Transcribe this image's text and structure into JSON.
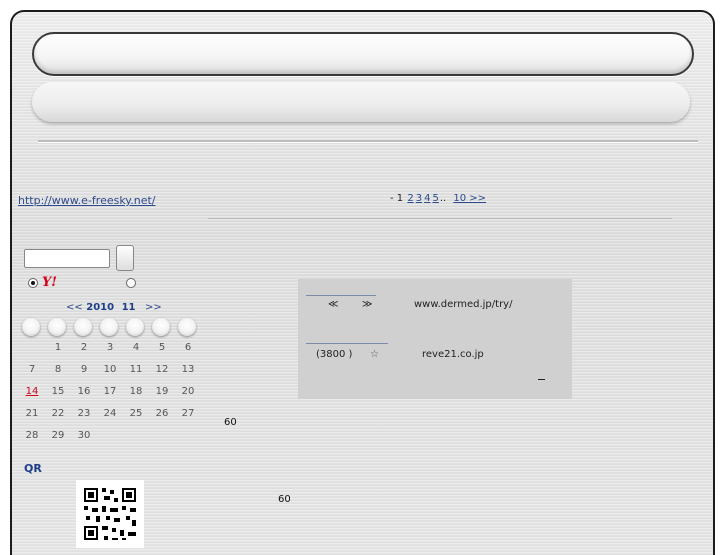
{
  "sidebar": {
    "site_link": "http://www.e-freesky.net/",
    "calendar": {
      "prev": "<<",
      "year": "2010",
      "month": "11",
      "next": ">>",
      "today": "14",
      "rows": [
        [
          "",
          "1",
          "2",
          "3",
          "4",
          "5",
          "6"
        ],
        [
          "7",
          "8",
          "9",
          "10",
          "11",
          "12",
          "13"
        ],
        [
          "14",
          "15",
          "16",
          "17",
          "18",
          "19",
          "20"
        ],
        [
          "21",
          "22",
          "23",
          "24",
          "25",
          "26",
          "27"
        ],
        [
          "28",
          "29",
          "30",
          "",
          "",
          "",
          ""
        ]
      ]
    },
    "yahoo_logo": "Y!",
    "qr_label": "QR"
  },
  "pager": {
    "prefix": "- 1",
    "pages": [
      "2",
      "3",
      "4",
      "5"
    ],
    "ellipsis": "..",
    "last": "10 >>"
  },
  "panel": {
    "prev_symbol": "≪",
    "next_symbol": "≫",
    "url1": "www.dermed.jp/try/",
    "price": "(3800 )",
    "star": "☆",
    "url2": "reve21.co.jp",
    "dash": "–"
  },
  "misc": {
    "count_a": "60",
    "count_b": "60"
  },
  "colors": {
    "link": "#2c4a8c",
    "today": "#d0021b",
    "frame_border": "#1c1c1c"
  }
}
